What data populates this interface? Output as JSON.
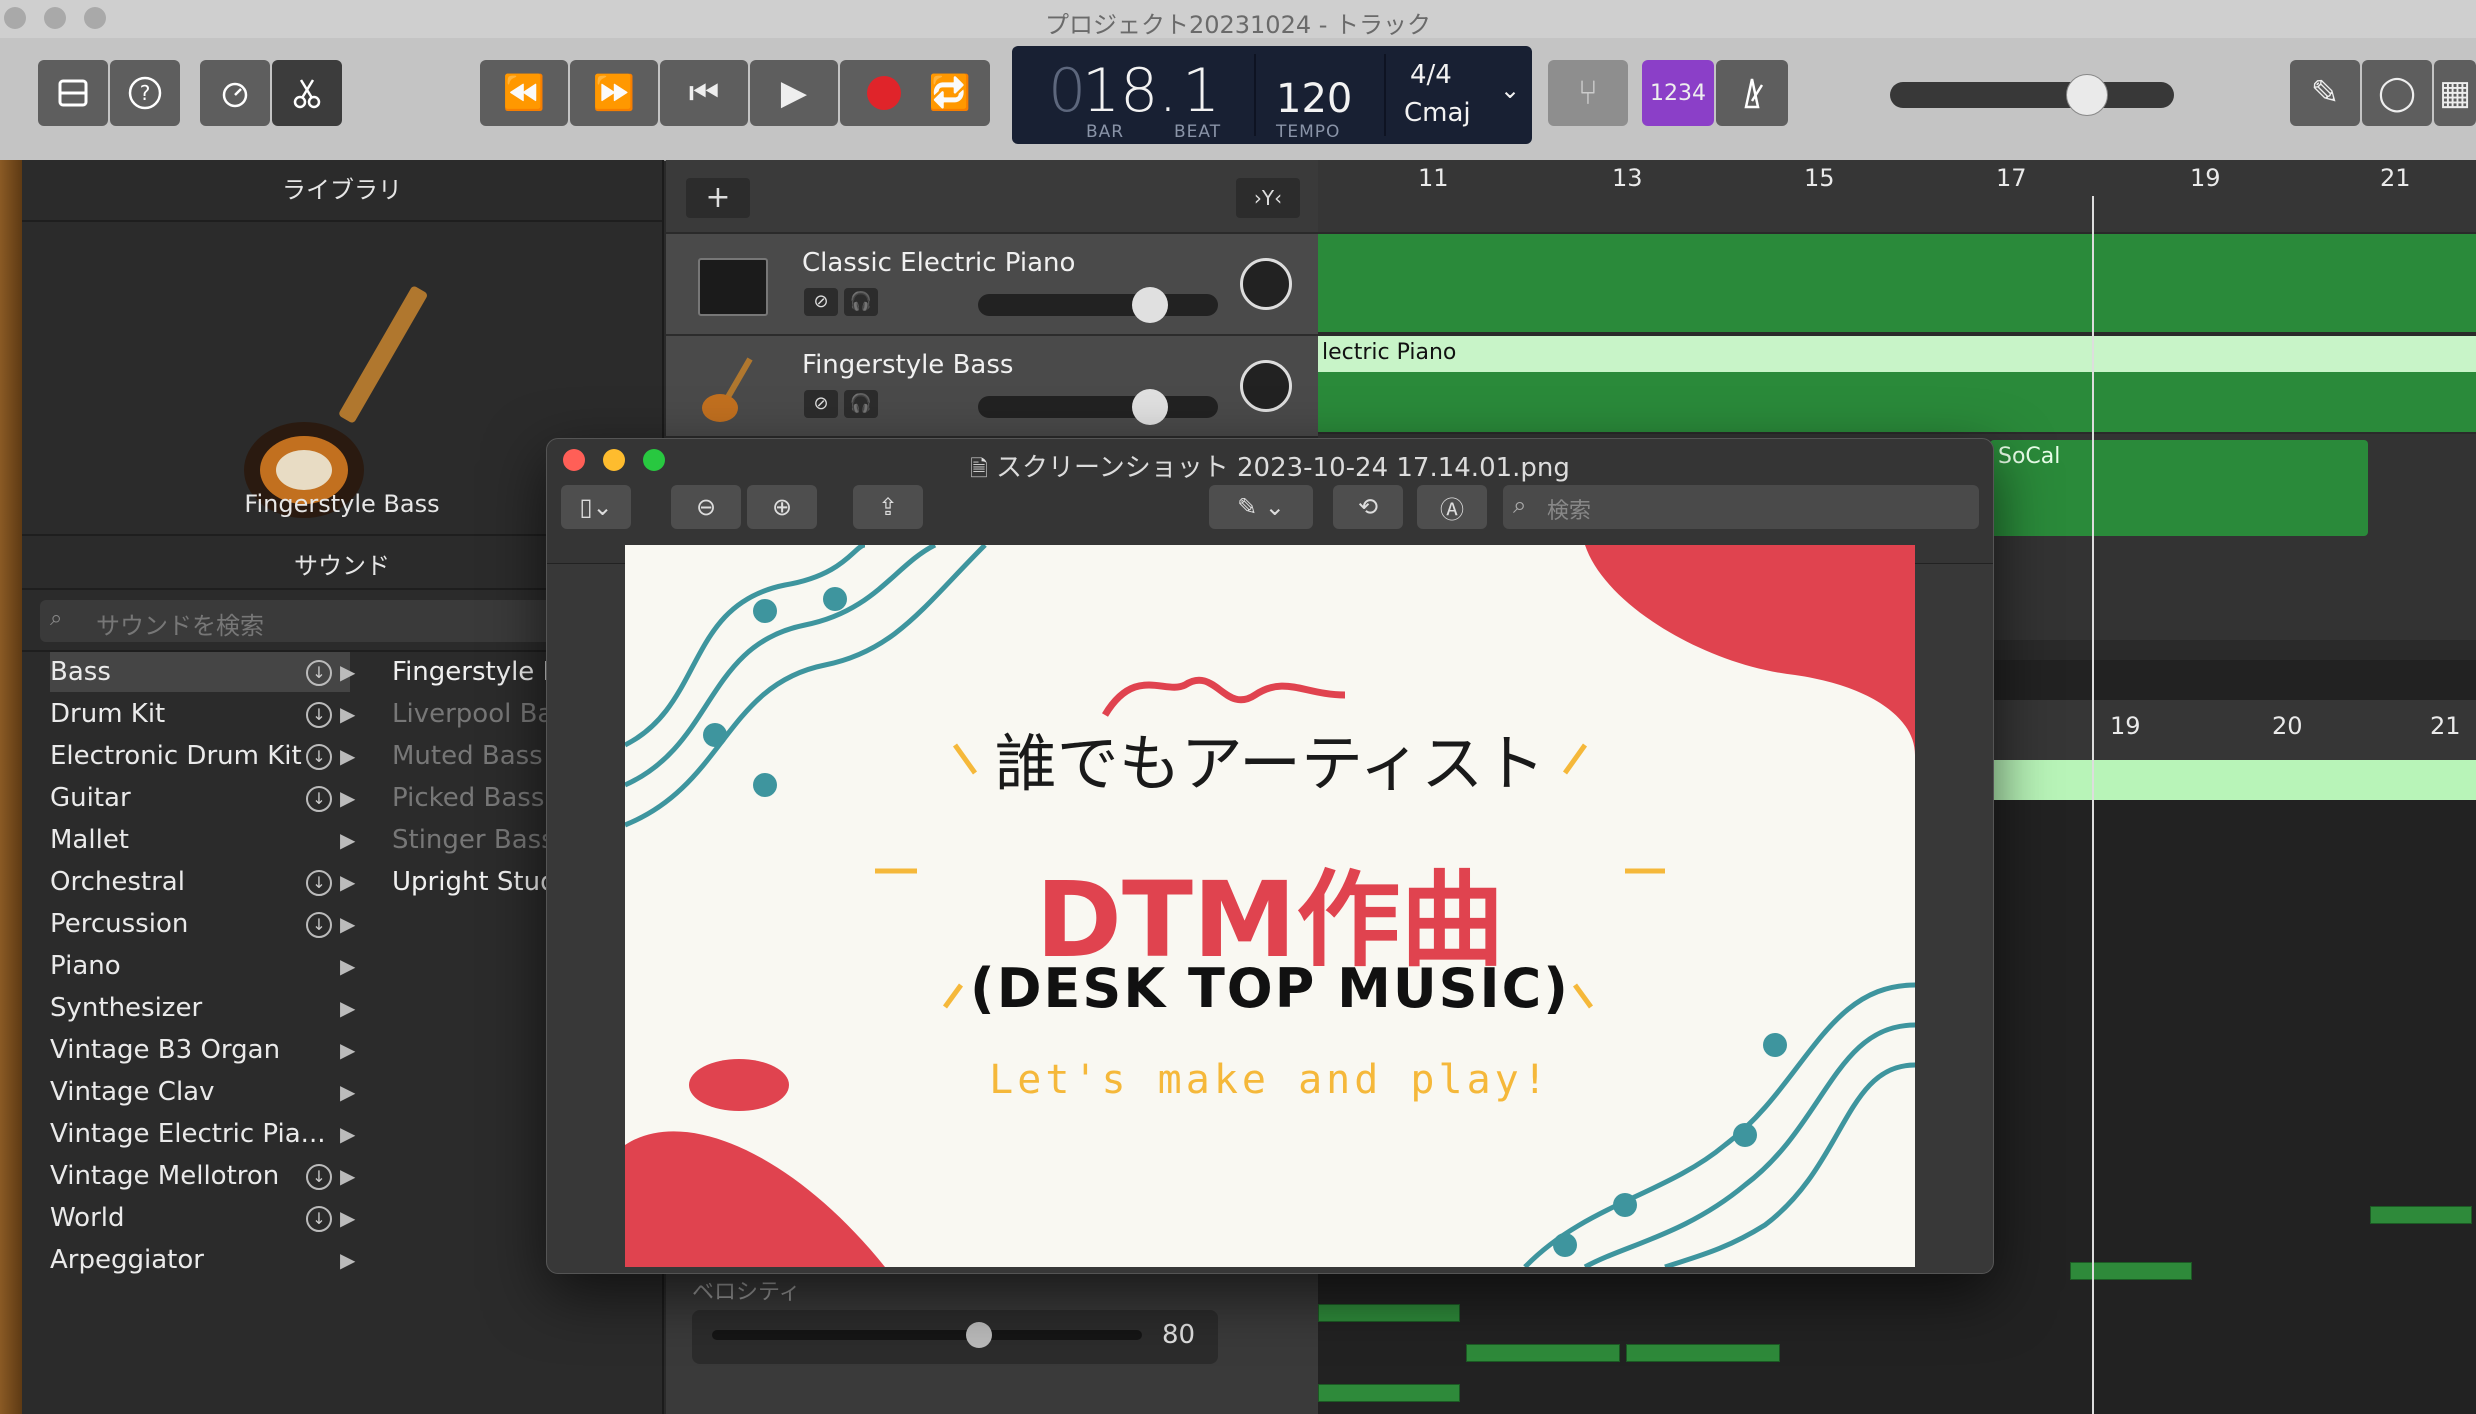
{
  "window": {
    "title": "プロジェクト20231024 - トラック"
  },
  "lcd": {
    "bar_digit": "18.",
    "beat_digit": "1",
    "bar_label": "BAR",
    "beat_label": "BEAT",
    "tempo": "120",
    "tempo_label": "TEMPO",
    "signature": "4/4",
    "key": "Cmaj"
  },
  "toolbar": {
    "count_in": "1234"
  },
  "library": {
    "header": "ライブラリ",
    "instrument_name": "Fingerstyle Bass",
    "sound_header": "サウンド",
    "search_placeholder": "サウンドを検索",
    "categories": [
      {
        "label": "Bass"
      },
      {
        "label": "Drum Kit"
      },
      {
        "label": "Electronic Drum Kit"
      },
      {
        "label": "Guitar"
      },
      {
        "label": "Mallet"
      },
      {
        "label": "Orchestral"
      },
      {
        "label": "Percussion"
      },
      {
        "label": "Piano"
      },
      {
        "label": "Synthesizer"
      },
      {
        "label": "Vintage B3 Organ"
      },
      {
        "label": "Vintage Clav"
      },
      {
        "label": "Vintage Electric Pia..."
      },
      {
        "label": "Vintage Mellotron"
      },
      {
        "label": "World"
      },
      {
        "label": "Arpeggiator"
      }
    ],
    "patches": [
      {
        "label": "Fingerstyle Ba"
      },
      {
        "label": "Liverpool Bass"
      },
      {
        "label": "Muted Bass"
      },
      {
        "label": "Picked Bass"
      },
      {
        "label": "Stinger Bass"
      },
      {
        "label": "Upright Studio"
      }
    ]
  },
  "tracks": [
    {
      "name": "Classic Electric Piano"
    },
    {
      "name": "Fingerstyle Bass"
    }
  ],
  "ruler": {
    "marks": [
      "11",
      "13",
      "15",
      "17",
      "19",
      "21"
    ]
  },
  "regions": {
    "piano_region_label": "lectric Piano",
    "socal_label": "SoCal"
  },
  "lower_ruler": {
    "marks": [
      "19",
      "20",
      "21"
    ]
  },
  "velocity": {
    "label": "ベロシティ",
    "value": "80"
  },
  "preview": {
    "title": "スクリーンショット 2023-10-24 17.14.01.png",
    "search_placeholder": "検索",
    "image": {
      "headline": "誰でもアーティスト",
      "title": "DTM作曲",
      "subtitle": "(DESK TOP MUSIC)",
      "tagline": "Let's make and play!"
    }
  },
  "colors": {
    "accent_red": "#e0434f",
    "teal": "#3e959e",
    "yellow": "#f5b83a",
    "green_region": "#2a8a3a"
  }
}
